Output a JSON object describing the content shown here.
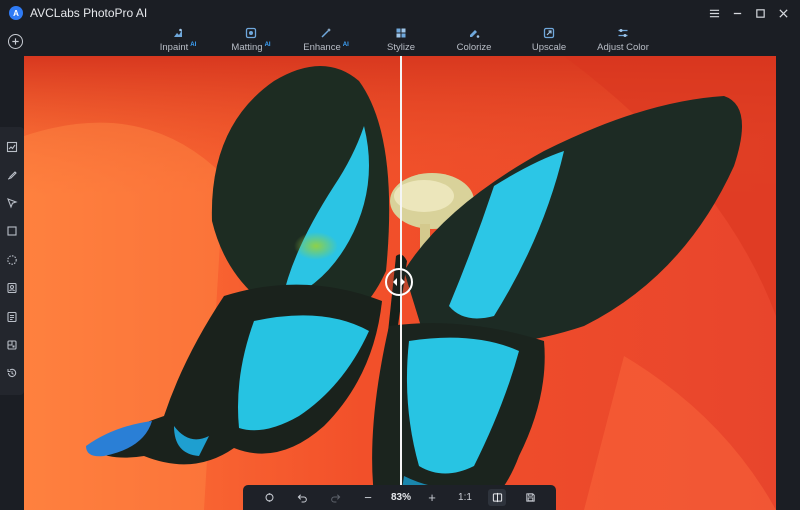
{
  "app": {
    "title": "AVCLabs PhotoPro AI",
    "logo_letter": "A"
  },
  "tabs": [
    {
      "label": "Inpaint",
      "ai": "AI",
      "icon": "inpaint-icon"
    },
    {
      "label": "Matting",
      "ai": "AI",
      "icon": "matting-icon"
    },
    {
      "label": "Enhance",
      "ai": "AI",
      "icon": "enhance-icon"
    },
    {
      "label": "Stylize",
      "ai": "",
      "icon": "stylize-icon"
    },
    {
      "label": "Colorize",
      "ai": "",
      "icon": "colorize-icon"
    },
    {
      "label": "Upscale",
      "ai": "",
      "icon": "upscale-icon"
    },
    {
      "label": "Adjust Color",
      "ai": "",
      "icon": "adjust-color-icon"
    }
  ],
  "left_tools": [
    "image-adjust-icon",
    "brush-icon",
    "select-pointer-icon",
    "rectangle-select-icon",
    "ellipse-select-icon",
    "portrait-icon",
    "document-icon",
    "layers-icon",
    "history-icon"
  ],
  "bottombar": {
    "zoom": "83%",
    "ratio": "1:1",
    "zoom_out": "−",
    "zoom_in": "+"
  },
  "colors": {
    "accent": "#2f7bf5",
    "ai_badge": "#3ea6ff",
    "background": "#1b1e24",
    "canvas_main": "#f0502b",
    "butterfly_wing": "#1c2a22",
    "butterfly_blue": "#25c9e8"
  }
}
